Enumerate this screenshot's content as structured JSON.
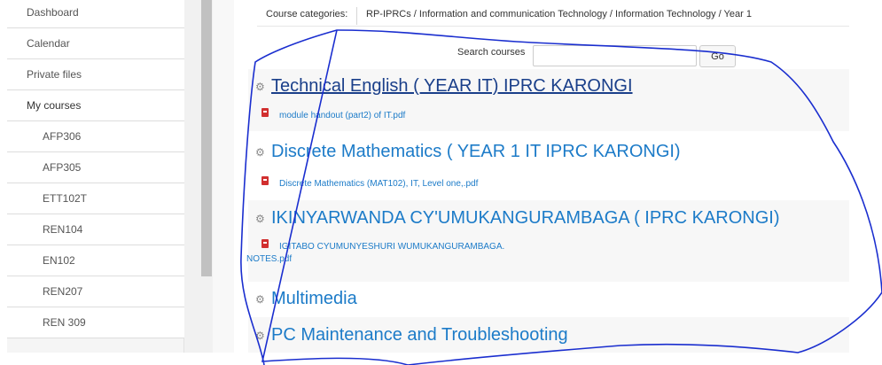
{
  "nav": {
    "items": [
      {
        "label": "Dashboard",
        "level": "top"
      },
      {
        "label": "Calendar",
        "level": "top"
      },
      {
        "label": "Private files",
        "level": "top"
      },
      {
        "label": "My courses",
        "level": "top"
      },
      {
        "label": "AFP306",
        "level": "sub"
      },
      {
        "label": "AFP305",
        "level": "sub"
      },
      {
        "label": "ETT102T",
        "level": "sub"
      },
      {
        "label": "REN104",
        "level": "sub"
      },
      {
        "label": "EN102",
        "level": "sub"
      },
      {
        "label": "REN207",
        "level": "sub"
      },
      {
        "label": "REN 309",
        "level": "sub"
      }
    ]
  },
  "breadcrumb": {
    "label": "Course categories:",
    "value": "RP-IPRCs / Information and communication Technology / Information Technology / Year 1"
  },
  "search": {
    "label": "Search courses",
    "value": "",
    "button": "Go"
  },
  "courses": [
    {
      "title": "Technical English ( YEAR IT) IPRC KARONGI",
      "file": "module handout (part2) of IT.pdf"
    },
    {
      "title": "Discrete Mathematics ( YEAR 1 IT IPRC KARONGI)",
      "file": "Discrete Mathematics (MAT102), IT, Level one,.pdf"
    },
    {
      "title": "IKINYARWANDA CY'UMUKANGURAMBAGA ( IPRC KARONGI)",
      "file_line1": "IGITABO CYUMUNYESHURI WUMUKANGURAMBAGA.",
      "file_line2": "NOTES.pdf"
    },
    {
      "title": "Multimedia"
    },
    {
      "title": "PC Maintenance and Troubleshooting"
    }
  ],
  "colors": {
    "link": "#1c7bc8",
    "annotation": "#1a2ecf"
  }
}
